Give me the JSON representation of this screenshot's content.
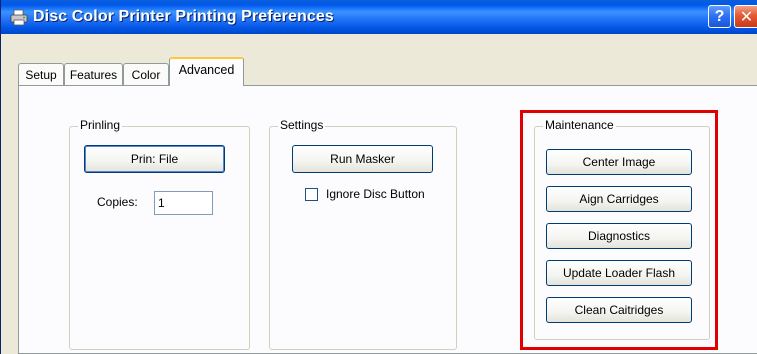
{
  "window": {
    "title": "Disc Color Printer Printing Preferences",
    "help_label": "?",
    "close_label": "✕"
  },
  "tabs": [
    {
      "label": "Setup"
    },
    {
      "label": "Features"
    },
    {
      "label": "Color"
    },
    {
      "label": "Advanced",
      "active": true
    }
  ],
  "printing": {
    "group_label": "Prinling",
    "print_file_label": "Prin: File",
    "copies_label": "Copies:",
    "copies_value": "1"
  },
  "settings": {
    "group_label": "Settings",
    "run_masker_label": "Run Masker",
    "ignore_disc_label": "Ignore Disc Button",
    "ignore_disc_checked": false
  },
  "maintenance": {
    "group_label": "Maintenance",
    "buttons": [
      {
        "label": "Center Image"
      },
      {
        "label": "Aign Carridges"
      },
      {
        "label": "Diagnostics"
      },
      {
        "label": "Update Loader Flash"
      },
      {
        "label": "Clean Caitridges"
      }
    ]
  },
  "colors": {
    "titlebar": "#0054e3",
    "highlight": "#e00000",
    "active_tab_accent": "#ffc83c"
  }
}
